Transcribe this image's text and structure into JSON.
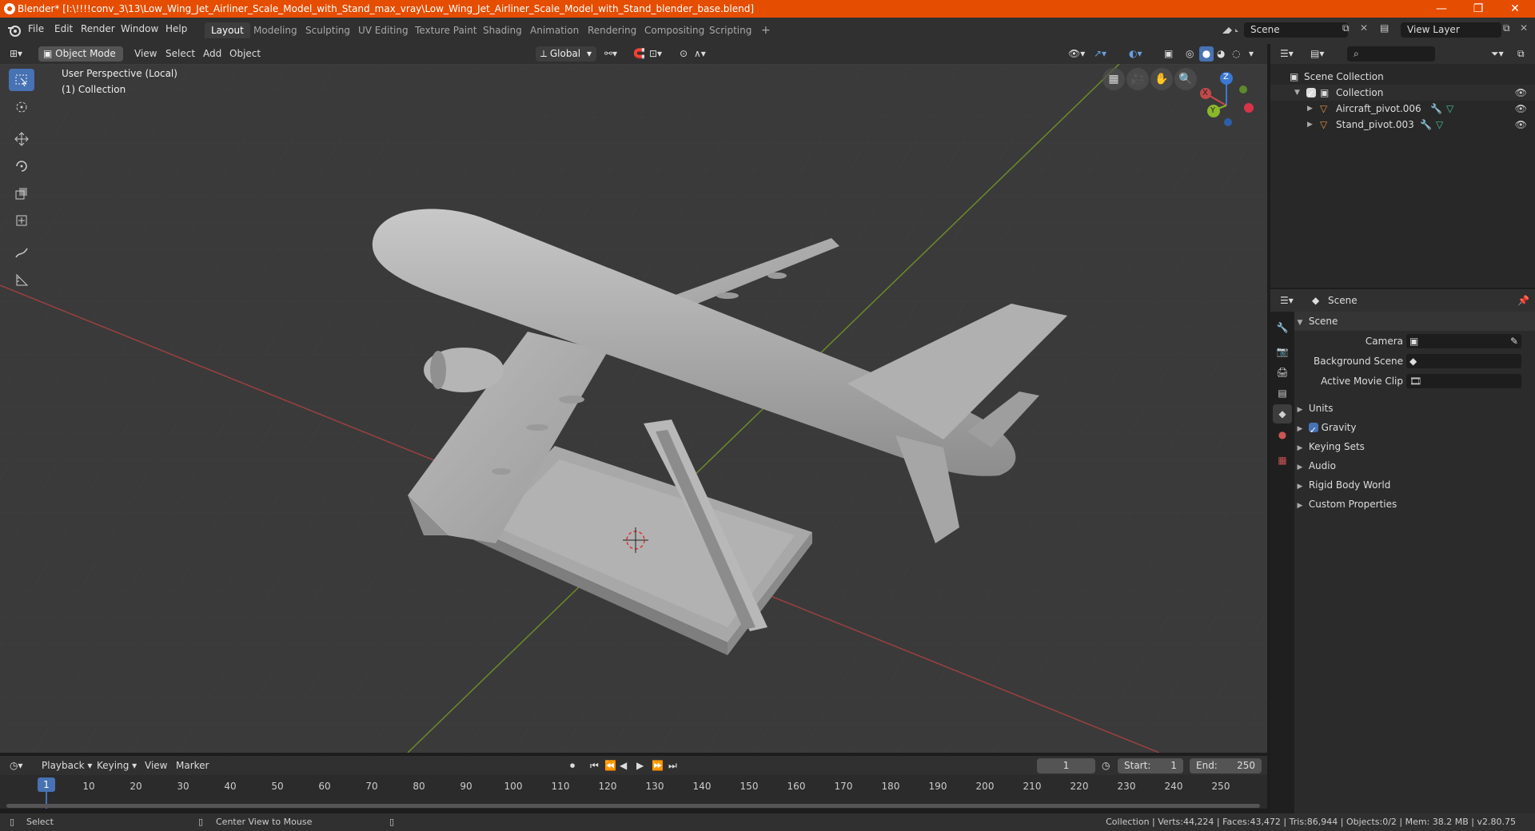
{
  "title_bar": {
    "title": "Blender* [I:\\!!!!conv_3\\13\\Low_Wing_Jet_Airliner_Scale_Model_with_Stand_max_vray\\Low_Wing_Jet_Airliner_Scale_Model_with_Stand_blender_base.blend]",
    "minimize": "—",
    "maximize": "❐",
    "close": "✕"
  },
  "menu": {
    "items": [
      "File",
      "Edit",
      "Render",
      "Window",
      "Help"
    ],
    "workspaces": [
      "Layout",
      "Modeling",
      "Sculpting",
      "UV Editing",
      "Texture Paint",
      "Shading",
      "Animation",
      "Rendering",
      "Compositing",
      "Scripting"
    ],
    "active_workspace": "Layout",
    "add_tab": "+",
    "scene_name": "Scene",
    "view_layer": "View Layer"
  },
  "viewport_header": {
    "mode": "Object Mode",
    "menus": [
      "View",
      "Select",
      "Add",
      "Object"
    ],
    "transform_orientation": "Global"
  },
  "viewport": {
    "perspective_label": "User Perspective (Local)",
    "collection_label": "(1) Collection",
    "gizmo": {
      "z": "Z",
      "y": "Y",
      "x": "X"
    }
  },
  "outliner": {
    "root": "Scene Collection",
    "collection": "Collection",
    "objects": [
      "Aircraft_pivot.006",
      "Stand_pivot.003"
    ]
  },
  "properties": {
    "header_title": "Scene",
    "panel_title": "Scene",
    "fields": [
      {
        "label": "Camera",
        "value": ""
      },
      {
        "label": "Background Scene",
        "value": ""
      },
      {
        "label": "Active Movie Clip",
        "value": ""
      }
    ],
    "subpanels": [
      "Units",
      "Gravity",
      "Keying Sets",
      "Audio",
      "Rigid Body World",
      "Custom Properties"
    ],
    "gravity_checked": true
  },
  "timeline": {
    "menus": [
      "Playback",
      "Keying",
      "View",
      "Marker"
    ],
    "current_frame": "1",
    "start_label": "Start:",
    "start_value": "1",
    "end_label": "End:",
    "end_value": "250",
    "ticks": [
      "10",
      "20",
      "30",
      "40",
      "50",
      "60",
      "70",
      "80",
      "90",
      "100",
      "110",
      "120",
      "130",
      "140",
      "150",
      "160",
      "170",
      "180",
      "190",
      "200",
      "210",
      "220",
      "230",
      "240",
      "250"
    ],
    "playhead_label": "1"
  },
  "status_bar": {
    "left_action": "Select",
    "mid_action": "Center View to Mouse",
    "stats": "Collection | Verts:44,224 | Faces:43,472 | Tris:86,944 | Objects:0/2 | Mem: 38.2 MB | v2.80.75"
  },
  "colors": {
    "title_bar": "#e54d00",
    "active_blue": "#4772b3",
    "x_axis": "#c44b4b",
    "y_axis": "#7a9b2a"
  }
}
